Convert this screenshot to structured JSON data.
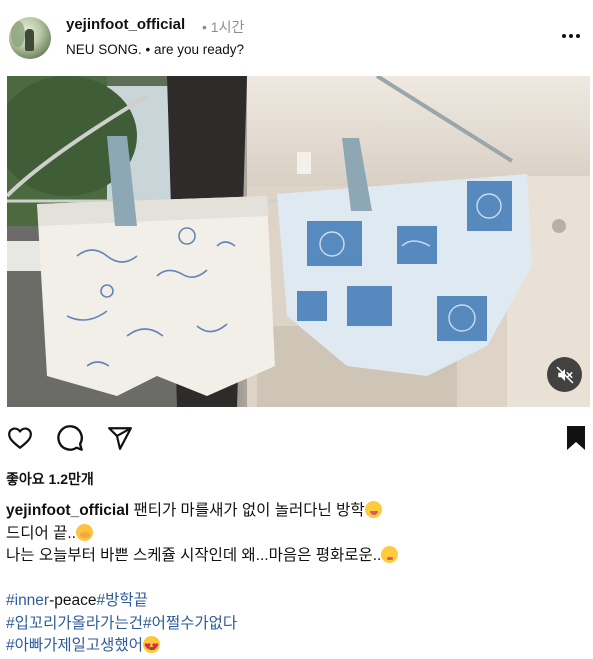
{
  "post": {
    "username": "yejinfoot_official",
    "time_sep": "•",
    "time": "1시간",
    "subtitle": "NEU SONG. • are you ready?",
    "more_icon": "more-horizontal-icon"
  },
  "media": {
    "type": "video",
    "mute_icon": "speaker-muted-icon"
  },
  "actions": {
    "like_icon": "heart-icon",
    "comment_icon": "comment-icon",
    "share_icon": "send-icon",
    "save_icon": "bookmark-icon"
  },
  "likes": {
    "label": "좋아요 1.2만개"
  },
  "caption": {
    "username": "yejinfoot_official",
    "line1": "팬티가 마를새가 없이 놀러다닌 방학",
    "line2": "드디어 끝..",
    "line3": "나는 오늘부터 바쁜 스케쥴 시작인데 왜...마음은 평화로운..",
    "hashtag1": "#inner",
    "hashtag1_rest": "-peace",
    "hashtag2": "#방학끝",
    "hashtag3": "#입꼬리가올라가는건",
    "hashtag4": "#어쩔수가없다",
    "hashtag5": "#아빠가제일고생했어"
  },
  "colors": {
    "hashtag": "#2f5c9c",
    "muted_text": "#8e8e8e",
    "mute_button_bg": "#262626"
  }
}
